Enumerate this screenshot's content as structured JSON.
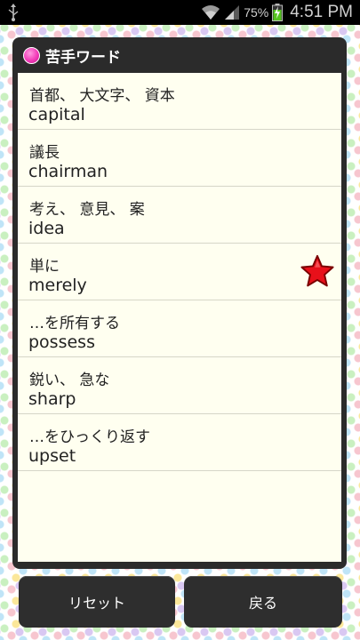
{
  "status_bar": {
    "battery_percent": "75%",
    "time": "4:51 PM",
    "icons": [
      "usb-icon",
      "wifi-icon",
      "signal-icon",
      "battery-charging-icon"
    ]
  },
  "panel": {
    "title": "苦手ワード",
    "title_icon": "pink-dot-icon",
    "items": [
      {
        "jp": "首都、 大文字、 資本",
        "en": "capital",
        "starred": false
      },
      {
        "jp": "議長",
        "en": "chairman",
        "starred": false
      },
      {
        "jp": "考え、 意見、 案",
        "en": "idea",
        "starred": false
      },
      {
        "jp": "単に",
        "en": "merely",
        "starred": true
      },
      {
        "jp": "…を所有する",
        "en": "possess",
        "starred": false
      },
      {
        "jp": "鋭い、 急な",
        "en": "sharp",
        "starred": false
      },
      {
        "jp": "…をひっくり返す",
        "en": "upset",
        "starred": false
      }
    ]
  },
  "buttons": {
    "reset_label": "リセット",
    "back_label": "戻る"
  },
  "colors": {
    "panel_bg": "#2b2b2b",
    "list_bg": "#fffff0",
    "button_bg": "#2e2e2e",
    "star": "#e8101a"
  }
}
